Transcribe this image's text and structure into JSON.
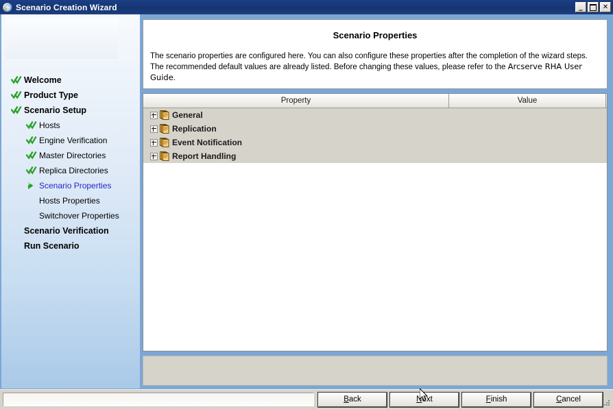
{
  "window": {
    "title": "Scenario Creation Wizard",
    "icon": "arcserve-globe-icon",
    "controls": {
      "minimize": "_",
      "maximize": "□",
      "close": "✕"
    }
  },
  "sidebar": {
    "items": [
      {
        "label": "Welcome",
        "level": "top",
        "state": "done"
      },
      {
        "label": "Product Type",
        "level": "top",
        "state": "done"
      },
      {
        "label": "Scenario Setup",
        "level": "top",
        "state": "done"
      },
      {
        "label": "Hosts",
        "level": "sub",
        "state": "done"
      },
      {
        "label": "Engine Verification",
        "level": "sub",
        "state": "done"
      },
      {
        "label": "Master Directories",
        "level": "sub",
        "state": "done"
      },
      {
        "label": "Replica Directories",
        "level": "sub",
        "state": "done"
      },
      {
        "label": "Scenario Properties",
        "level": "sub",
        "state": "current"
      },
      {
        "label": "Hosts Properties",
        "level": "sub",
        "state": "pending"
      },
      {
        "label": "Switchover Properties",
        "level": "sub",
        "state": "pending"
      },
      {
        "label": "Scenario Verification",
        "level": "top",
        "state": "pending"
      },
      {
        "label": "Run Scenario",
        "level": "top",
        "state": "pending"
      }
    ],
    "colors": {
      "done_marker": "#2aa12a",
      "current_marker": "#2aa12a",
      "current_text": "#2424cc"
    }
  },
  "main": {
    "title": "Scenario Properties",
    "description_line1": "The scenario properties are configured here. You can also configure these properties after the completion of the wizard steps.",
    "description_line2_pre": "The recommended default values are already listed. Before changing these values, please refer to the ",
    "description_line2_guide": "Arcserve RHA User Guide",
    "description_line2_post": ".",
    "tree": {
      "columns": [
        "Property",
        "Value"
      ],
      "rows": [
        {
          "property": "General",
          "value": "",
          "expanded": false,
          "icon": "documents-stack-icon"
        },
        {
          "property": "Replication",
          "value": "",
          "expanded": false,
          "icon": "documents-stack-icon"
        },
        {
          "property": "Event Notification",
          "value": "",
          "expanded": false,
          "icon": "documents-stack-icon"
        },
        {
          "property": "Report Handling",
          "value": "",
          "expanded": false,
          "icon": "documents-stack-icon"
        }
      ]
    }
  },
  "bottom": {
    "status_value": "",
    "buttons": [
      {
        "label": "Back",
        "accel": "B"
      },
      {
        "label": "Next",
        "accel": "N"
      },
      {
        "label": "Finish",
        "accel": "F"
      },
      {
        "label": "Cancel",
        "accel": "C"
      }
    ]
  }
}
